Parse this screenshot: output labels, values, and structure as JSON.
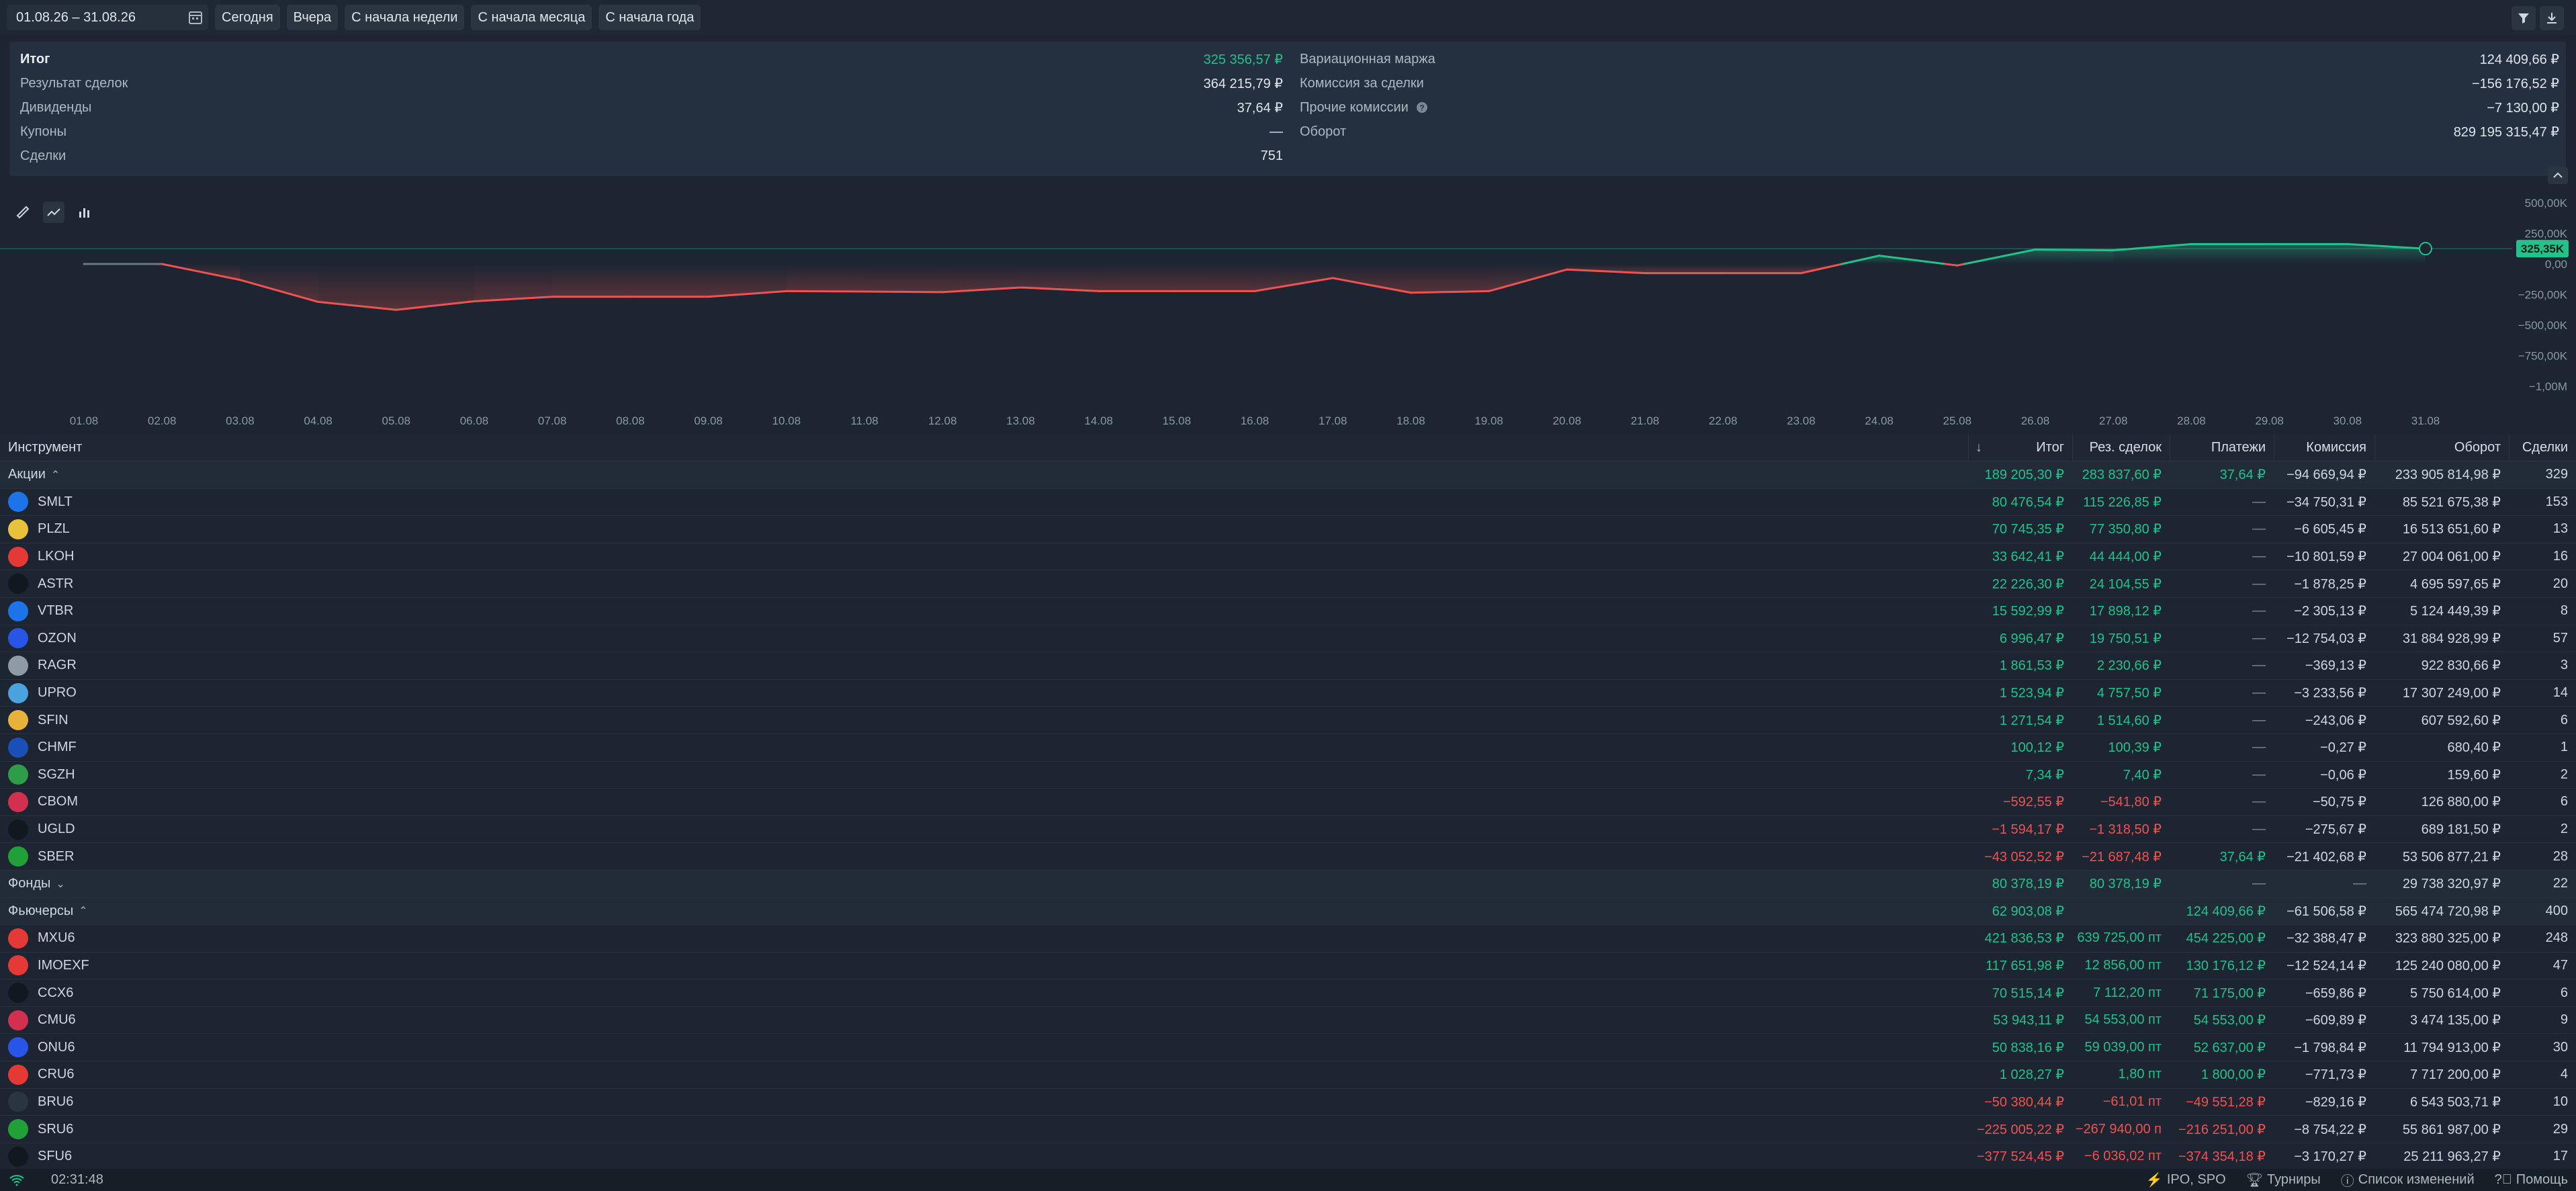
{
  "toolbar": {
    "date_range": "01.08.26 – 31.08.26",
    "buttons": [
      "Сегодня",
      "Вчера",
      "С начала недели",
      "С начала месяца",
      "С начала года"
    ]
  },
  "summary": {
    "left": [
      {
        "label": "Итог",
        "value": "325 356,57 ₽",
        "positive": true,
        "bold": true
      },
      {
        "label": "Результат сделок",
        "value": "364 215,79 ₽"
      },
      {
        "label": "Дивиденды",
        "value": "37,64 ₽"
      },
      {
        "label": "Купоны",
        "value": "—"
      },
      {
        "label": "Сделки",
        "value": "751"
      }
    ],
    "right": [
      {
        "label": "Вариационная маржа",
        "value": "124 409,66 ₽"
      },
      {
        "label": "Комиссия за сделки",
        "value": "−156 176,52 ₽"
      },
      {
        "label": "Прочие комиссии",
        "value": "−7 130,00 ₽"
      },
      {
        "label": "Оборот",
        "value": "829 195 315,47 ₽"
      }
    ]
  },
  "chart_data": {
    "type": "line",
    "x": [
      "01.08",
      "02.08",
      "03.08",
      "04.08",
      "05.08",
      "06.08",
      "07.08",
      "08.08",
      "09.08",
      "10.08",
      "11.08",
      "12.08",
      "13.08",
      "14.08",
      "15.08",
      "16.08",
      "17.08",
      "18.08",
      "19.08",
      "20.08",
      "21.08",
      "22.08",
      "23.08",
      "24.08",
      "25.08",
      "26.08",
      "27.08",
      "28.08",
      "29.08",
      "30.08",
      "31.08"
    ],
    "values": [
      0,
      0,
      -130000,
      -310000,
      -375000,
      -305000,
      -268000,
      -268000,
      -268000,
      -222000,
      -225000,
      -230000,
      -192000,
      -222000,
      -222000,
      -222000,
      -115000,
      -235000,
      -222000,
      -45000,
      -75000,
      -75000,
      -75000,
      68000,
      -12000,
      118000,
      112000,
      163000,
      163000,
      163000,
      125356
    ],
    "yticks": [
      "500,00K",
      "250,00K",
      "0,00",
      "−250,00K",
      "−500,00K",
      "−750,00K",
      "−1,00M"
    ],
    "ylim": [
      -1000000,
      500000
    ],
    "last_label": "325,35K"
  },
  "table": {
    "headers": {
      "instrument": "Инструмент",
      "total": "Итог",
      "deals_result": "Рез. сделок",
      "payments": "Платежи",
      "commission": "Комиссия",
      "turnover": "Оборот",
      "deals": "Сделки"
    },
    "rows": [
      {
        "group": true,
        "name": "Акции",
        "caret": "⌃",
        "total": "189 205,30 ₽",
        "res": "283 837,60 ₽",
        "pay": "37,64 ₽",
        "com": "−94 669,94 ₽",
        "turn": "233 905 814,98 ₽",
        "n": "329",
        "s": 1
      },
      {
        "name": "SMLT",
        "logo": "#1d73e8",
        "total": "80 476,54 ₽",
        "res": "115 226,85 ₽",
        "pay": "—",
        "com": "−34 750,31 ₽",
        "turn": "85 521 675,38 ₽",
        "n": "153",
        "s": 1
      },
      {
        "name": "PLZL",
        "logo": "#e8c23a",
        "total": "70 745,35 ₽",
        "res": "77 350,80 ₽",
        "pay": "—",
        "com": "−6 605,45 ₽",
        "turn": "16 513 651,60 ₽",
        "n": "13",
        "s": 1
      },
      {
        "name": "LKOH",
        "logo": "#e53935",
        "total": "33 642,41 ₽",
        "res": "44 444,00 ₽",
        "pay": "—",
        "com": "−10 801,59 ₽",
        "turn": "27 004 061,00 ₽",
        "n": "16",
        "s": 1
      },
      {
        "name": "ASTR",
        "logo": "#111820",
        "total": "22 226,30 ₽",
        "res": "24 104,55 ₽",
        "pay": "—",
        "com": "−1 878,25 ₽",
        "turn": "4 695 597,65 ₽",
        "n": "20",
        "s": 1
      },
      {
        "name": "VTBR",
        "logo": "#1d73e8",
        "total": "15 592,99 ₽",
        "res": "17 898,12 ₽",
        "pay": "—",
        "com": "−2 305,13 ₽",
        "turn": "5 124 449,39 ₽",
        "n": "8",
        "s": 1
      },
      {
        "name": "OZON",
        "logo": "#2855e6",
        "total": "6 996,47 ₽",
        "res": "19 750,51 ₽",
        "pay": "—",
        "com": "−12 754,03 ₽",
        "turn": "31 884 928,99 ₽",
        "n": "57",
        "s": 1
      },
      {
        "name": "RAGR",
        "logo": "#8e9aa6",
        "total": "1 861,53 ₽",
        "res": "2 230,66 ₽",
        "pay": "—",
        "com": "−369,13 ₽",
        "turn": "922 830,66 ₽",
        "n": "3",
        "s": 1
      },
      {
        "name": "UPRO",
        "logo": "#4aa3df",
        "total": "1 523,94 ₽",
        "res": "4 757,50 ₽",
        "pay": "—",
        "com": "−3 233,56 ₽",
        "turn": "17 307 249,00 ₽",
        "n": "14",
        "s": 1
      },
      {
        "name": "SFIN",
        "logo": "#e8b23a",
        "total": "1 271,54 ₽",
        "res": "1 514,60 ₽",
        "pay": "—",
        "com": "−243,06 ₽",
        "turn": "607 592,60 ₽",
        "n": "6",
        "s": 1
      },
      {
        "name": "CHMF",
        "logo": "#1b4fb8",
        "total": "100,12 ₽",
        "res": "100,39 ₽",
        "pay": "—",
        "com": "−0,27 ₽",
        "turn": "680,40 ₽",
        "n": "1",
        "s": 1
      },
      {
        "name": "SGZH",
        "logo": "#2e9d4a",
        "total": "7,34 ₽",
        "res": "7,40 ₽",
        "pay": "—",
        "com": "−0,06 ₽",
        "turn": "159,60 ₽",
        "n": "2",
        "s": 1
      },
      {
        "name": "CBOM",
        "logo": "#d32f4f",
        "total": "−592,55 ₽",
        "res": "−541,80 ₽",
        "pay": "—",
        "com": "−50,75 ₽",
        "turn": "126 880,00 ₽",
        "n": "6",
        "s": -1
      },
      {
        "name": "UGLD",
        "logo": "#111820",
        "total": "−1 594,17 ₽",
        "res": "−1 318,50 ₽",
        "pay": "—",
        "com": "−275,67 ₽",
        "turn": "689 181,50 ₽",
        "n": "2",
        "s": -1
      },
      {
        "name": "SBER",
        "logo": "#21a038",
        "total": "−43 052,52 ₽",
        "res": "−21 687,48 ₽",
        "pay": "37,64 ₽",
        "com": "−21 402,68 ₽",
        "turn": "53 506 877,21 ₽",
        "n": "28",
        "s": -1
      },
      {
        "group": true,
        "name": "Фонды",
        "caret": "⌄",
        "total": "80 378,19 ₽",
        "res": "80 378,19 ₽",
        "pay": "—",
        "com": "—",
        "turn": "29 738 320,97 ₽",
        "n": "22",
        "s": 1
      },
      {
        "group": true,
        "name": "Фьючерсы",
        "caret": "⌃",
        "total": "62 903,08 ₽",
        "res": "",
        "pay": "124 409,66 ₽",
        "com": "−61 506,58 ₽",
        "turn": "565 474 720,98 ₽",
        "n": "400",
        "s": 1
      },
      {
        "name": "MXU6",
        "logo": "#e53935",
        "total": "421 836,53 ₽",
        "res": "639 725,00 пт",
        "pay": "454 225,00 ₽",
        "com": "−32 388,47 ₽",
        "turn": "323 880 325,00 ₽",
        "n": "248",
        "s": 1
      },
      {
        "name": "IMOEXF",
        "logo": "#e53935",
        "total": "117 651,98 ₽",
        "res": "12 856,00 пт",
        "pay": "130 176,12 ₽",
        "com": "−12 524,14 ₽",
        "turn": "125 240 080,00 ₽",
        "n": "47",
        "s": 1
      },
      {
        "name": "CCX6",
        "logo": "#111820",
        "total": "70 515,14 ₽",
        "res": "7 112,20 пт",
        "pay": "71 175,00 ₽",
        "com": "−659,86 ₽",
        "turn": "5 750 614,00 ₽",
        "n": "6",
        "s": 1
      },
      {
        "name": "CMU6",
        "logo": "#d32f4f",
        "total": "53 943,11 ₽",
        "res": "54 553,00 пт",
        "pay": "54 553,00 ₽",
        "com": "−609,89 ₽",
        "turn": "3 474 135,00 ₽",
        "n": "9",
        "s": 1
      },
      {
        "name": "ONU6",
        "logo": "#2855e6",
        "total": "50 838,16 ₽",
        "res": "59 039,00 пт",
        "pay": "52 637,00 ₽",
        "com": "−1 798,84 ₽",
        "turn": "11 794 913,00 ₽",
        "n": "30",
        "s": 1
      },
      {
        "name": "CRU6",
        "logo": "#e53935",
        "total": "1 028,27 ₽",
        "res": "1,80 пт",
        "pay": "1 800,00 ₽",
        "com": "−771,73 ₽",
        "turn": "7 717 200,00 ₽",
        "n": "4",
        "s": 1
      },
      {
        "name": "BRU6",
        "logo": "#2b3541",
        "total": "−50 380,44 ₽",
        "res": "−61,01 пт",
        "pay": "−49 551,28 ₽",
        "com": "−829,16 ₽",
        "turn": "6 543 503,71 ₽",
        "n": "10",
        "s": -1
      },
      {
        "name": "SRU6",
        "logo": "#21a038",
        "total": "−225 005,22 ₽",
        "res": "−267 940,00 п",
        "pay": "−216 251,00 ₽",
        "com": "−8 754,22 ₽",
        "turn": "55 861 987,00 ₽",
        "n": "29",
        "s": -1
      },
      {
        "name": "SFU6",
        "logo": "#111820",
        "total": "−377 524,45 ₽",
        "res": "−6 036,02 пт",
        "pay": "−374 354,18 ₽",
        "com": "−3 170,27 ₽",
        "turn": "25 211 963,27 ₽",
        "n": "17",
        "s": -1
      }
    ]
  },
  "footer": {
    "time": "02:31:48",
    "ipo": "IPO, SPO",
    "tournaments": "Турниры",
    "changelog": "Список изменений",
    "help": "Помощь"
  }
}
